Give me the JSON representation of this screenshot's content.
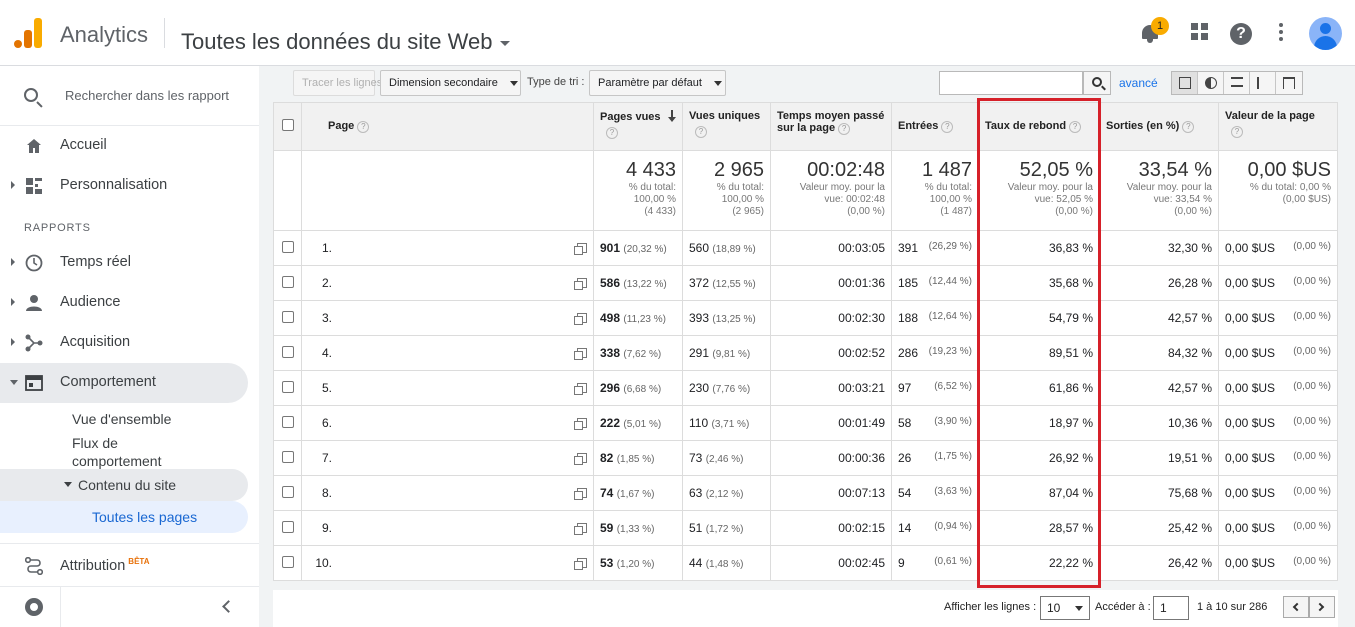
{
  "header": {
    "app_name": "Analytics",
    "property": "Toutes les données du site Web",
    "notification_count": "1"
  },
  "sidebar": {
    "search_placeholder": "Rechercher dans les rapport",
    "home": "Accueil",
    "customization": "Personnalisation",
    "section_reports": "RAPPORTS",
    "realtime": "Temps réel",
    "audience": "Audience",
    "acquisition": "Acquisition",
    "behavior": "Comportement",
    "overview": "Vue d'ensemble",
    "behavior_flow_1": "Flux de",
    "behavior_flow_2": "comportement",
    "site_content": "Contenu du site",
    "all_pages": "Toutes les pages",
    "attribution": "Attribution",
    "beta": "BÊTA"
  },
  "toolbar": {
    "plot_rows": "Tracer les lignes",
    "secondary_dimension": "Dimension secondaire",
    "sort_type_label": "Type de tri :",
    "sort_default": "Paramètre par défaut",
    "search_value": "",
    "advanced": "avancé"
  },
  "table": {
    "headers": {
      "page": "Page",
      "pageviews": "Pages vues",
      "unique": "Vues uniques",
      "avg_time_1": "Temps moyen passé",
      "avg_time_2": "sur la page",
      "entrances": "Entrées",
      "bounce": "Taux de rebond",
      "exit": "Sorties (en %)",
      "value": "Valeur de la page"
    },
    "totals": {
      "pageviews": {
        "big": "4 433",
        "l1": "% du total:",
        "l2": "100,00 %",
        "l3": "(4 433)"
      },
      "unique": {
        "big": "2 965",
        "l1": "% du total:",
        "l2": "100,00 %",
        "l3": "(2 965)"
      },
      "avg_time": {
        "big": "00:02:48",
        "l1": "Valeur moy. pour la",
        "l2": "vue: 00:02:48",
        "l3": "(0,00 %)"
      },
      "entrances": {
        "big": "1 487",
        "l1": "% du total:",
        "l2": "100,00 %",
        "l3": "(1 487)"
      },
      "bounce": {
        "big": "52,05 %",
        "l1": "Valeur moy. pour la",
        "l2": "vue: 52,05 %",
        "l3": "(0,00 %)"
      },
      "exit": {
        "big": "33,54 %",
        "l1": "Valeur moy. pour la",
        "l2": "vue: 33,54 %",
        "l3": "(0,00 %)"
      },
      "value": {
        "big": "0,00 $US",
        "l1": "% du total: 0,00 %",
        "l2": "(0,00 $US)",
        "l3": ""
      }
    },
    "rows": [
      {
        "idx": "1.",
        "pv": "901",
        "pv_pct": "(20,32 %)",
        "uv": "560",
        "uv_pct": "(18,89 %)",
        "time": "00:03:05",
        "ent": "391",
        "ent_pct": "(26,29 %)",
        "bounce": "36,83 %",
        "exit": "32,30 %",
        "val": "0,00 $US",
        "val_pct": "(0,00 %)"
      },
      {
        "idx": "2.",
        "pv": "586",
        "pv_pct": "(13,22 %)",
        "uv": "372",
        "uv_pct": "(12,55 %)",
        "time": "00:01:36",
        "ent": "185",
        "ent_pct": "(12,44 %)",
        "bounce": "35,68 %",
        "exit": "26,28 %",
        "val": "0,00 $US",
        "val_pct": "(0,00 %)"
      },
      {
        "idx": "3.",
        "pv": "498",
        "pv_pct": "(11,23 %)",
        "uv": "393",
        "uv_pct": "(13,25 %)",
        "time": "00:02:30",
        "ent": "188",
        "ent_pct": "(12,64 %)",
        "bounce": "54,79 %",
        "exit": "42,57 %",
        "val": "0,00 $US",
        "val_pct": "(0,00 %)"
      },
      {
        "idx": "4.",
        "pv": "338",
        "pv_pct": "(7,62 %)",
        "uv": "291",
        "uv_pct": "(9,81 %)",
        "time": "00:02:52",
        "ent": "286",
        "ent_pct": "(19,23 %)",
        "bounce": "89,51 %",
        "exit": "84,32 %",
        "val": "0,00 $US",
        "val_pct": "(0,00 %)"
      },
      {
        "idx": "5.",
        "pv": "296",
        "pv_pct": "(6,68 %)",
        "uv": "230",
        "uv_pct": "(7,76 %)",
        "time": "00:03:21",
        "ent": "97",
        "ent_pct": "(6,52 %)",
        "bounce": "61,86 %",
        "exit": "42,57 %",
        "val": "0,00 $US",
        "val_pct": "(0,00 %)"
      },
      {
        "idx": "6.",
        "pv": "222",
        "pv_pct": "(5,01 %)",
        "uv": "110",
        "uv_pct": "(3,71 %)",
        "time": "00:01:49",
        "ent": "58",
        "ent_pct": "(3,90 %)",
        "bounce": "18,97 %",
        "exit": "10,36 %",
        "val": "0,00 $US",
        "val_pct": "(0,00 %)"
      },
      {
        "idx": "7.",
        "pv": "82",
        "pv_pct": "(1,85 %)",
        "uv": "73",
        "uv_pct": "(2,46 %)",
        "time": "00:00:36",
        "ent": "26",
        "ent_pct": "(1,75 %)",
        "bounce": "26,92 %",
        "exit": "19,51 %",
        "val": "0,00 $US",
        "val_pct": "(0,00 %)"
      },
      {
        "idx": "8.",
        "pv": "74",
        "pv_pct": "(1,67 %)",
        "uv": "63",
        "uv_pct": "(2,12 %)",
        "time": "00:07:13",
        "ent": "54",
        "ent_pct": "(3,63 %)",
        "bounce": "87,04 %",
        "exit": "75,68 %",
        "val": "0,00 $US",
        "val_pct": "(0,00 %)"
      },
      {
        "idx": "9.",
        "pv": "59",
        "pv_pct": "(1,33 %)",
        "uv": "51",
        "uv_pct": "(1,72 %)",
        "time": "00:02:15",
        "ent": "14",
        "ent_pct": "(0,94 %)",
        "bounce": "28,57 %",
        "exit": "25,42 %",
        "val": "0,00 $US",
        "val_pct": "(0,00 %)"
      },
      {
        "idx": "10.",
        "pv": "53",
        "pv_pct": "(1,20 %)",
        "uv": "44",
        "uv_pct": "(1,48 %)",
        "time": "00:02:45",
        "ent": "9",
        "ent_pct": "(0,61 %)",
        "bounce": "22,22 %",
        "exit": "26,42 %",
        "val": "0,00 $US",
        "val_pct": "(0,00 %)"
      }
    ]
  },
  "footer": {
    "show_rows_label": "Afficher les lignes :",
    "show_rows_value": "10",
    "goto_label": "Accéder à :",
    "goto_value": "1",
    "range": "1 à 10 sur 286"
  },
  "colors": {
    "accent": "#1a73e8",
    "highlight": "#d62029",
    "logo_orange": "#e37400",
    "logo_yellow": "#f9ab00"
  }
}
